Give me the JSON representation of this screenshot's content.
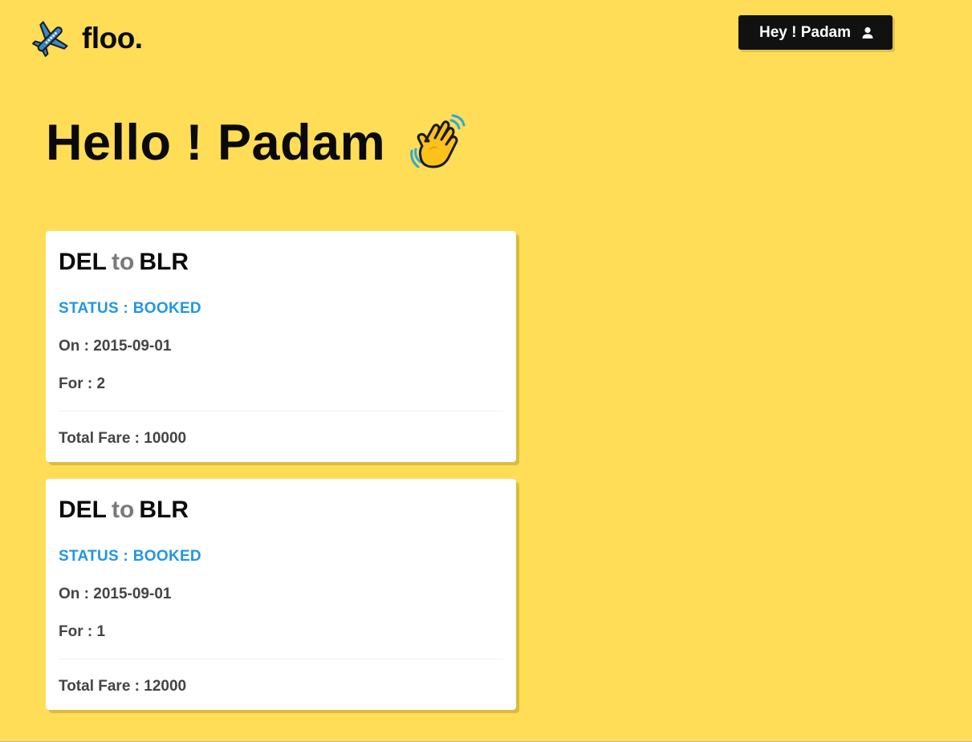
{
  "brand": {
    "icon": "airplane-icon",
    "name": "floo."
  },
  "header": {
    "user_button_label": "Hey ! Padam",
    "user_icon": "user-icon"
  },
  "greeting": {
    "text": "Hello ! Padam",
    "icon": "waving-hand-icon"
  },
  "bookings": [
    {
      "from": "DEL",
      "connector": "to",
      "to": "BLR",
      "status": "STATUS : BOOKED",
      "date": "On : 2015-09-01",
      "passengers": "For : 2",
      "fare": "Total Fare : 10000"
    },
    {
      "from": "DEL",
      "connector": "to",
      "to": "BLR",
      "status": "STATUS : BOOKED",
      "date": "On : 2015-09-01",
      "passengers": "For : 1",
      "fare": "Total Fare : 12000"
    }
  ],
  "colors": {
    "background": "#FFDD57",
    "status": "#2196e6",
    "button": "#111111"
  }
}
